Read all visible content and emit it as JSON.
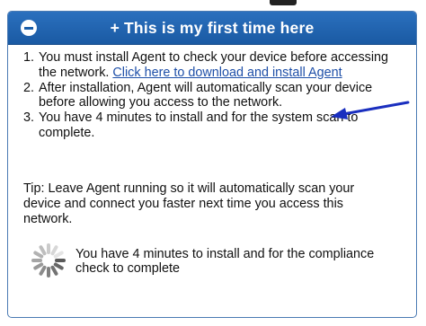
{
  "header": {
    "collapse_icon": "minus-circle-icon",
    "title": "+ This is my first time here"
  },
  "steps": [
    {
      "number": "1.",
      "text": "You must install Agent to check your device before accessing the network. ",
      "link": "Click here to download and install Agent"
    },
    {
      "number": "2.",
      "text": "After installation, Agent will automatically scan your device before allowing you access to the network."
    },
    {
      "number": "3.",
      "text": "You have 4 minutes to install and for the system scan to complete."
    }
  ],
  "tip": "Tip: Leave Agent running so it will automatically scan your device and connect you faster next time you access this network.",
  "status": {
    "icon": "loading-spinner-icon",
    "text": "You have 4 minutes to install and for the compliance check to complete"
  },
  "colors": {
    "header": "#1b5ea9",
    "link": "#1e4fa8",
    "annotation_arrow": "#1a2fbf"
  }
}
